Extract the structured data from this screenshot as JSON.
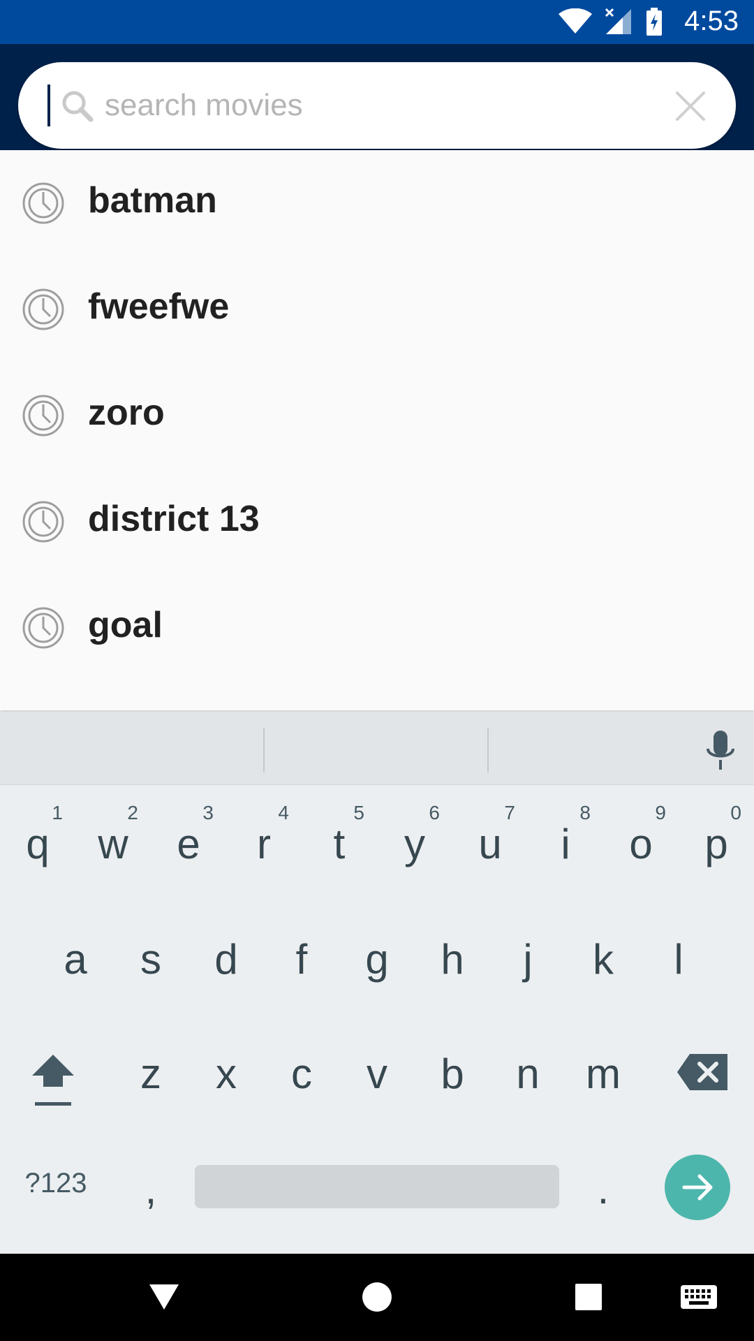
{
  "status_bar": {
    "time": "4:53"
  },
  "search": {
    "placeholder": "search movies",
    "value": ""
  },
  "suggestions": [
    {
      "label": "batman"
    },
    {
      "label": "fweefwe"
    },
    {
      "label": "zoro"
    },
    {
      "label": "district 13"
    },
    {
      "label": "goal"
    }
  ],
  "keyboard": {
    "row1": [
      {
        "ch": "q",
        "num": "1"
      },
      {
        "ch": "w",
        "num": "2"
      },
      {
        "ch": "e",
        "num": "3"
      },
      {
        "ch": "r",
        "num": "4"
      },
      {
        "ch": "t",
        "num": "5"
      },
      {
        "ch": "y",
        "num": "6"
      },
      {
        "ch": "u",
        "num": "7"
      },
      {
        "ch": "i",
        "num": "8"
      },
      {
        "ch": "o",
        "num": "9"
      },
      {
        "ch": "p",
        "num": "0"
      }
    ],
    "row2": [
      "a",
      "s",
      "d",
      "f",
      "g",
      "h",
      "j",
      "k",
      "l"
    ],
    "row3": [
      "z",
      "x",
      "c",
      "v",
      "b",
      "n",
      "m"
    ],
    "symbols_label": "?123",
    "comma": ",",
    "period": "."
  },
  "colors": {
    "status_bar": "#004A9E",
    "app_bar": "#00214A",
    "enter_key": "#4DB6AC"
  },
  "icons": [
    "wifi-icon",
    "signal-icon",
    "battery-icon",
    "search-icon",
    "close-icon",
    "history-icon",
    "mic-icon",
    "shift-icon",
    "backspace-icon",
    "arrow-right-icon",
    "nav-back-icon",
    "nav-home-icon",
    "nav-recents-icon",
    "keyboard-icon"
  ]
}
